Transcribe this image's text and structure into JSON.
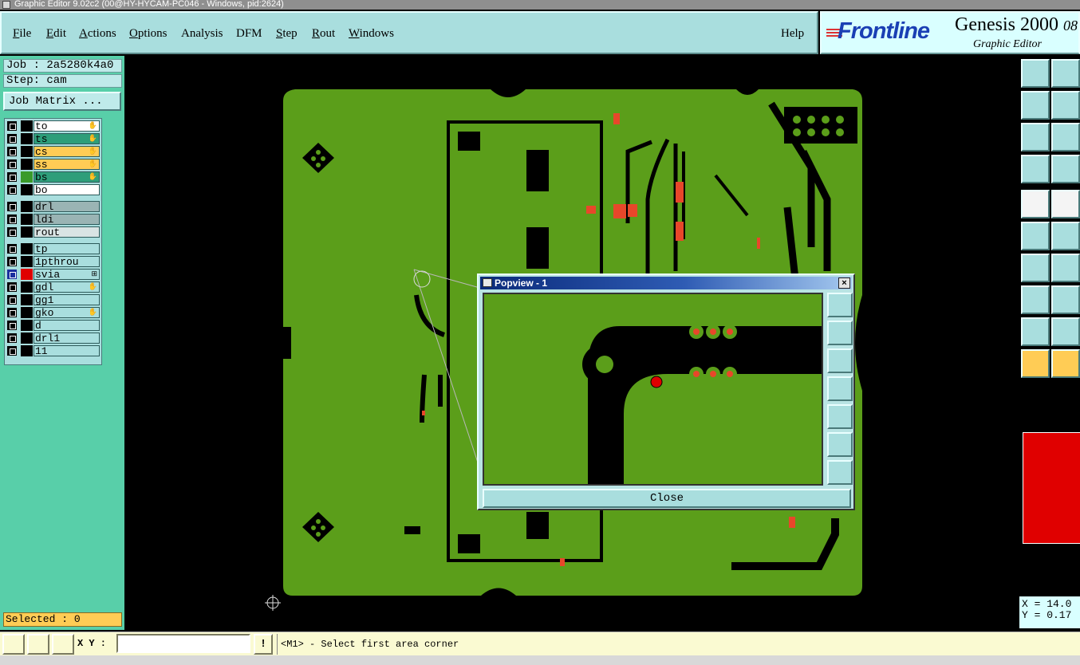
{
  "window": {
    "title": "Graphic Editor 9.02c2 (00@HY-HYCAM-PC046 - Windows, pid:2624)"
  },
  "menu": {
    "items": [
      "File",
      "Edit",
      "Actions",
      "Options",
      "Analysis",
      "DFM",
      "Step",
      "Rout",
      "Windows"
    ],
    "help": "Help"
  },
  "brand": {
    "logo": "Frontline",
    "product": "Genesis 2000",
    "version_fragment": "08",
    "subtitle": "Graphic Editor"
  },
  "job": {
    "job_label": "Job : 2a5280k4a0",
    "step_label": "Step: cam",
    "matrix_button": "Job Matrix ..."
  },
  "layers": [
    {
      "name": "to",
      "color": "#ffffff",
      "mark": "✋"
    },
    {
      "name": "ts",
      "color": "#2e9e7a",
      "mark": "✋"
    },
    {
      "name": "cs",
      "color": "#ffcc55",
      "mark": "✋"
    },
    {
      "name": "ss",
      "color": "#ffcc55",
      "mark": "✋"
    },
    {
      "name": "bs",
      "color": "#2e9e7a",
      "mark": "✋",
      "swatch": "#3a9a2a"
    },
    {
      "name": "bo",
      "color": "#ffffff",
      "mark": ""
    },
    {
      "name": "drl",
      "color": "#9ab4b4",
      "mark": ""
    },
    {
      "name": "ldi",
      "color": "#9ab4b4",
      "mark": ""
    },
    {
      "name": "rout",
      "color": "#d9e4e4",
      "mark": ""
    },
    {
      "name": "tp",
      "color": "#a9dede",
      "mark": ""
    },
    {
      "name": "1pthrou",
      "color": "#a9dede",
      "mark": ""
    },
    {
      "name": "svia",
      "color": "#a9dede",
      "mark": "⊞",
      "swatch": "#e00000",
      "checkbox": "#1a2f9e"
    },
    {
      "name": "gdl",
      "color": "#a9dede",
      "mark": "✋"
    },
    {
      "name": "gg1",
      "color": "#a9dede",
      "mark": ""
    },
    {
      "name": "gko",
      "color": "#a9dede",
      "mark": "✋"
    },
    {
      "name": "d",
      "color": "#a9dede",
      "mark": ""
    },
    {
      "name": "drl1",
      "color": "#a9dede",
      "mark": ""
    },
    {
      "name": "11",
      "color": "#a9dede",
      "mark": ""
    }
  ],
  "selected": {
    "label": "Selected : 0"
  },
  "coords": {
    "x": "X = 14.0",
    "y": "Y = 0.17"
  },
  "status": {
    "xy_label": "X Y :",
    "xy_value": "",
    "message": "<M1> - Select first area corner"
  },
  "popview": {
    "title": "Popview - 1",
    "close_label": "Close"
  },
  "colors": {
    "board": "#5b9e1a",
    "pad": "#e8472a",
    "accent": "#a9dede",
    "layer_highlight": "#ffcc55"
  }
}
